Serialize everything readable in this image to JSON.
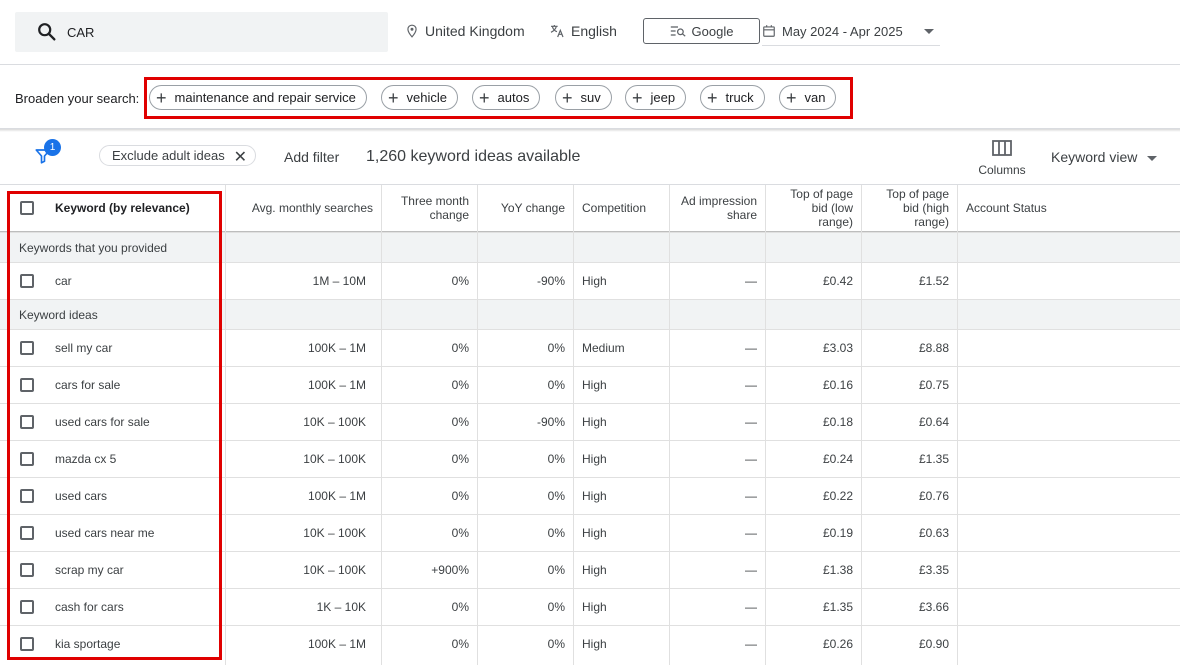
{
  "search": {
    "query": "CAR"
  },
  "topbar": {
    "location": "United Kingdom",
    "language": "English",
    "network": "Google",
    "date_range": "May 2024 - Apr 2025"
  },
  "broaden": {
    "label": "Broaden your search:",
    "chips": [
      "maintenance and repair service",
      "vehicle",
      "autos",
      "suv",
      "jeep",
      "truck",
      "van"
    ]
  },
  "filters": {
    "badge_count": "1",
    "active_filter": "Exclude adult ideas",
    "add_filter": "Add filter",
    "ideas_count": "1,260 keyword ideas available",
    "columns_label": "Columns",
    "view_label": "Keyword view"
  },
  "table": {
    "headers": {
      "keyword": "Keyword (by relevance)",
      "avg": "Avg. monthly searches",
      "three_month": "Three month change",
      "yoy": "YoY change",
      "competition": "Competition",
      "impression": "Ad impression share",
      "bid_low": "Top of page bid (low range)",
      "bid_high": "Top of page bid (high range)",
      "status": "Account Status"
    },
    "group_provided": "Keywords that you provided",
    "group_ideas": "Keyword ideas",
    "provided": [
      {
        "keyword": "car",
        "avg": "1M – 10M",
        "three_month": "0%",
        "yoy": "-90%",
        "competition": "High",
        "impression": "—",
        "bid_low": "£0.42",
        "bid_high": "£1.52"
      }
    ],
    "ideas": [
      {
        "keyword": "sell my car",
        "avg": "100K – 1M",
        "three_month": "0%",
        "yoy": "0%",
        "competition": "Medium",
        "impression": "—",
        "bid_low": "£3.03",
        "bid_high": "£8.88"
      },
      {
        "keyword": "cars for sale",
        "avg": "100K – 1M",
        "three_month": "0%",
        "yoy": "0%",
        "competition": "High",
        "impression": "—",
        "bid_low": "£0.16",
        "bid_high": "£0.75"
      },
      {
        "keyword": "used cars for sale",
        "avg": "10K – 100K",
        "three_month": "0%",
        "yoy": "-90%",
        "competition": "High",
        "impression": "—",
        "bid_low": "£0.18",
        "bid_high": "£0.64"
      },
      {
        "keyword": "mazda cx 5",
        "avg": "10K – 100K",
        "three_month": "0%",
        "yoy": "0%",
        "competition": "High",
        "impression": "—",
        "bid_low": "£0.24",
        "bid_high": "£1.35"
      },
      {
        "keyword": "used cars",
        "avg": "100K – 1M",
        "three_month": "0%",
        "yoy": "0%",
        "competition": "High",
        "impression": "—",
        "bid_low": "£0.22",
        "bid_high": "£0.76"
      },
      {
        "keyword": "used cars near me",
        "avg": "10K – 100K",
        "three_month": "0%",
        "yoy": "0%",
        "competition": "High",
        "impression": "—",
        "bid_low": "£0.19",
        "bid_high": "£0.63"
      },
      {
        "keyword": "scrap my car",
        "avg": "10K – 100K",
        "three_month": "+900%",
        "yoy": "0%",
        "competition": "High",
        "impression": "—",
        "bid_low": "£1.38",
        "bid_high": "£3.35"
      },
      {
        "keyword": "cash for cars",
        "avg": "1K – 10K",
        "three_month": "0%",
        "yoy": "0%",
        "competition": "High",
        "impression": "—",
        "bid_low": "£1.35",
        "bid_high": "£3.66"
      },
      {
        "keyword": "kia sportage",
        "avg": "100K – 1M",
        "three_month": "0%",
        "yoy": "0%",
        "competition": "High",
        "impression": "—",
        "bid_low": "£0.26",
        "bid_high": "£0.90"
      }
    ]
  },
  "colors": {
    "highlight": "#e00000",
    "accent": "#1a73e8"
  }
}
